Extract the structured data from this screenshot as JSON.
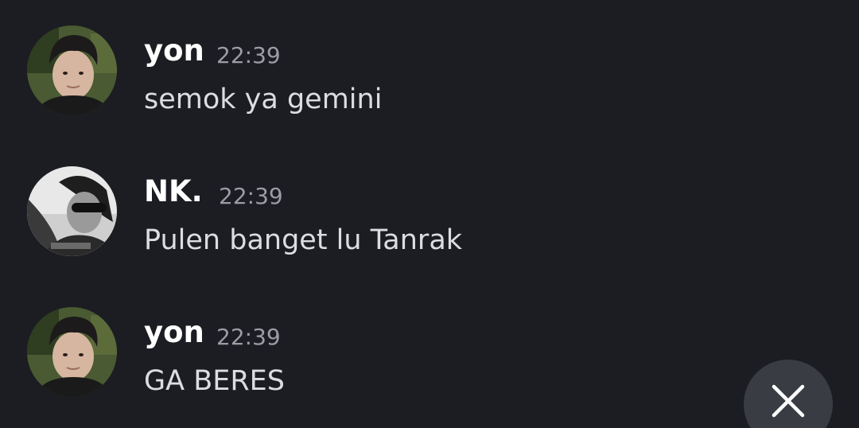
{
  "messages": [
    {
      "author": "yon",
      "timestamp": "22:39",
      "text": "semok ya gemini",
      "avatar_icon": "user-photo-avatar"
    },
    {
      "author": "NK.",
      "timestamp": "22:39",
      "text": "Pulen banget lu Tanrak",
      "avatar_icon": "user-photo-avatar-grayscale"
    },
    {
      "author": "yon",
      "timestamp": "22:39",
      "text": "GA BERES",
      "avatar_icon": "user-photo-avatar"
    }
  ],
  "close_button": {
    "icon": "close-icon"
  },
  "colors": {
    "background": "#1c1d22",
    "author": "#ffffff",
    "timestamp": "#9b9ca6",
    "text": "#dcdde1",
    "fab": "#3a3c44"
  }
}
